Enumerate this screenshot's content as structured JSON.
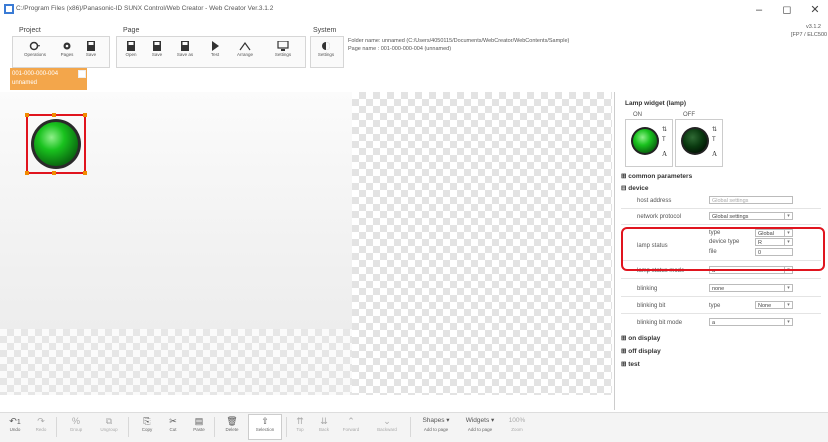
{
  "window": {
    "title": "C:/Program Files (x86)/Panasonic-ID SUNX Control/Web Creator - Web Creator Ver.3.1.2",
    "minimize": "–",
    "maximize": "◻",
    "close": "✕"
  },
  "version": {
    "line1": "v3.1.2",
    "line2": "[FP7 / ELC500"
  },
  "ribbon": {
    "groups": {
      "project": "Project",
      "page": "Page",
      "system": "System"
    },
    "project_buttons": [
      {
        "label": "Operations"
      },
      {
        "label": "Pages"
      },
      {
        "label": "Save"
      }
    ],
    "page_buttons": [
      {
        "label": "Open"
      },
      {
        "label": "Save"
      },
      {
        "label": "Save as"
      },
      {
        "label": "Test"
      },
      {
        "label": "Arrange"
      },
      {
        "label": "Settings"
      }
    ],
    "system_buttons": [
      {
        "label": "Settings"
      }
    ],
    "folder_name": "Folder name: unnamed (C:/Users/4050115/Documents/WebCreator/WebContents/Sample)",
    "page_name": "Page name : 001-000-000-004 (unnamed)"
  },
  "tab": {
    "id": "001-000-000-004",
    "name": "unnamed"
  },
  "panel": {
    "title": "Lamp widget (lamp)",
    "on_label": "ON",
    "off_label": "OFF",
    "preview_a": "A",
    "sections": {
      "common": "⊞ common parameters",
      "device": "⊟ device",
      "on_display": "⊞ on display",
      "off_display": "⊞ off display",
      "test": "⊞ test"
    },
    "host_address": {
      "label": "host address",
      "value": "Global settings"
    },
    "network_protocol": {
      "label": "network protocol",
      "value": "Global settings"
    },
    "lamp_status": {
      "label": "lamp status",
      "type_label": "type",
      "type_value": "Global",
      "device_type_label": "device type",
      "device_type_value": "R",
      "file_label": "file",
      "file_value": "0"
    },
    "lamp_status_mode": {
      "label": "lamp status mode",
      "value": "a"
    },
    "blinking": {
      "label": "blinking",
      "value": "none"
    },
    "blinking_bit": {
      "label": "blinking bit",
      "type_label": "type",
      "type_value": "None"
    },
    "blinking_bit_mode": {
      "label": "blinking bit mode",
      "value": "a"
    }
  },
  "toolbar": {
    "buttons": [
      {
        "label": "Undo",
        "icon": "↶"
      },
      {
        "label": "Redo",
        "icon": "↷"
      },
      {
        "label": "Group",
        "icon": "%"
      },
      {
        "label": "Ungroup",
        "icon": "⧉"
      },
      {
        "label": "Copy",
        "icon": "⎘"
      },
      {
        "label": "Cut",
        "icon": "✂"
      },
      {
        "label": "Paste",
        "icon": "▤"
      },
      {
        "label": "Delete",
        "icon": "🗑"
      },
      {
        "label": "Selection",
        "icon": "⇧"
      },
      {
        "label": "Top",
        "icon": "⇈"
      },
      {
        "label": "Back",
        "icon": "⇊"
      },
      {
        "label": "Forward",
        "icon": "⌃"
      },
      {
        "label": "Backward",
        "icon": "⌄"
      }
    ],
    "undo_count": "1",
    "shapes": {
      "label": "Shapes ▾",
      "sub": "Add to page"
    },
    "widgets": {
      "label": "Widgets ▾",
      "sub": "Add to page"
    },
    "zoom": {
      "value": "100%",
      "label": "Zoom"
    }
  },
  "colors": {
    "accent_tab": "#f3a64b",
    "selection": "#e0141e",
    "lamp_on": "#19c21e",
    "lamp_off": "#0a3a10"
  }
}
